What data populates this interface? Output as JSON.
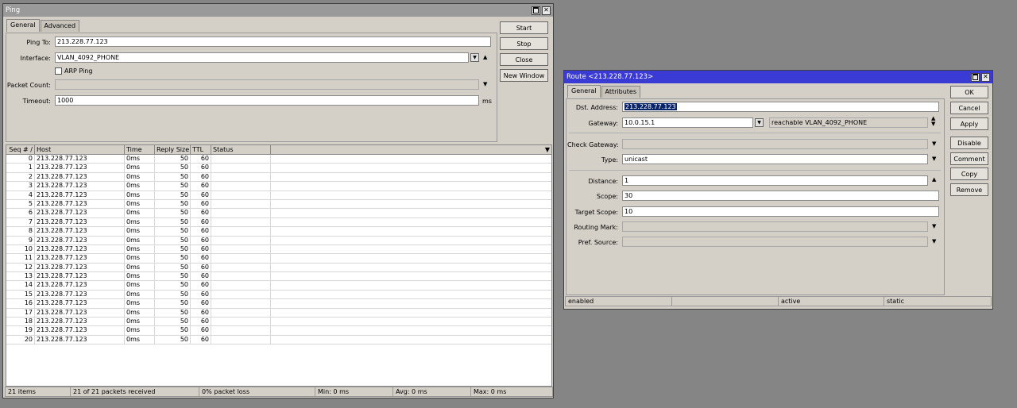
{
  "ping": {
    "title": "Ping",
    "tabs": [
      "General",
      "Advanced"
    ],
    "labels": {
      "ping_to": "Ping To:",
      "interface": "Interface:",
      "arp_ping": "ARP Ping",
      "packet_count": "Packet Count:",
      "timeout": "Timeout:",
      "timeout_unit": "ms"
    },
    "values": {
      "ping_to": "213.228.77.123",
      "interface": "VLAN_4092_PHONE",
      "packet_count": "",
      "timeout": "1000"
    },
    "buttons": [
      "Start",
      "Stop",
      "Close",
      "New Window"
    ],
    "columns": [
      "Seq #",
      "Host",
      "Time",
      "Reply Size",
      "TTL",
      "Status"
    ],
    "rows": [
      [
        "0",
        "213.228.77.123",
        "0ms",
        "50",
        "60",
        ""
      ],
      [
        "1",
        "213.228.77.123",
        "0ms",
        "50",
        "60",
        ""
      ],
      [
        "2",
        "213.228.77.123",
        "0ms",
        "50",
        "60",
        ""
      ],
      [
        "3",
        "213.228.77.123",
        "0ms",
        "50",
        "60",
        ""
      ],
      [
        "4",
        "213.228.77.123",
        "0ms",
        "50",
        "60",
        ""
      ],
      [
        "5",
        "213.228.77.123",
        "0ms",
        "50",
        "60",
        ""
      ],
      [
        "6",
        "213.228.77.123",
        "0ms",
        "50",
        "60",
        ""
      ],
      [
        "7",
        "213.228.77.123",
        "0ms",
        "50",
        "60",
        ""
      ],
      [
        "8",
        "213.228.77.123",
        "0ms",
        "50",
        "60",
        ""
      ],
      [
        "9",
        "213.228.77.123",
        "0ms",
        "50",
        "60",
        ""
      ],
      [
        "10",
        "213.228.77.123",
        "0ms",
        "50",
        "60",
        ""
      ],
      [
        "11",
        "213.228.77.123",
        "0ms",
        "50",
        "60",
        ""
      ],
      [
        "12",
        "213.228.77.123",
        "0ms",
        "50",
        "60",
        ""
      ],
      [
        "13",
        "213.228.77.123",
        "0ms",
        "50",
        "60",
        ""
      ],
      [
        "14",
        "213.228.77.123",
        "0ms",
        "50",
        "60",
        ""
      ],
      [
        "15",
        "213.228.77.123",
        "0ms",
        "50",
        "60",
        ""
      ],
      [
        "16",
        "213.228.77.123",
        "0ms",
        "50",
        "60",
        ""
      ],
      [
        "17",
        "213.228.77.123",
        "0ms",
        "50",
        "60",
        ""
      ],
      [
        "18",
        "213.228.77.123",
        "0ms",
        "50",
        "60",
        ""
      ],
      [
        "19",
        "213.228.77.123",
        "0ms",
        "50",
        "60",
        ""
      ],
      [
        "20",
        "213.228.77.123",
        "0ms",
        "50",
        "60",
        ""
      ]
    ],
    "status": [
      "21 items",
      "21 of 21 packets received",
      "0% packet loss",
      "Min: 0 ms",
      "Avg: 0 ms",
      "Max: 0 ms"
    ]
  },
  "route": {
    "title": "Route <213.228.77.123>",
    "tabs": [
      "General",
      "Attributes"
    ],
    "labels": {
      "dst_address": "Dst. Address:",
      "gateway": "Gateway:",
      "check_gateway": "Check Gateway:",
      "type": "Type:",
      "distance": "Distance:",
      "scope": "Scope:",
      "target_scope": "Target Scope:",
      "routing_mark": "Routing Mark:",
      "pref_source": "Pref. Source:"
    },
    "values": {
      "dst_address": "213.228.77.123",
      "gateway": "10.0.15.1",
      "gateway_status": "reachable VLAN_4092_PHONE",
      "check_gateway": "",
      "type": "unicast",
      "distance": "1",
      "scope": "30",
      "target_scope": "10",
      "routing_mark": "",
      "pref_source": ""
    },
    "buttons": [
      "OK",
      "Cancel",
      "Apply",
      "Disable",
      "Comment",
      "Copy",
      "Remove"
    ],
    "status": [
      "enabled",
      "",
      "active",
      "static"
    ]
  }
}
